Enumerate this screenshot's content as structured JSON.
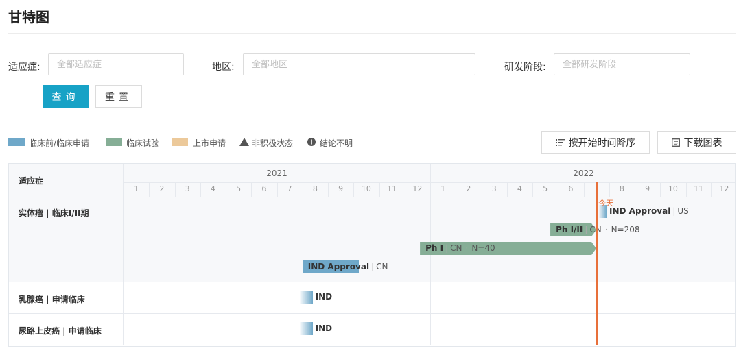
{
  "page": {
    "title": "甘特图"
  },
  "filters": [
    {
      "label": "适应症:",
      "placeholder": "全部适应症"
    },
    {
      "label": "地区:",
      "placeholder": "全部地区"
    },
    {
      "label": "研发阶段:",
      "placeholder": "全部研发阶段"
    }
  ],
  "buttons": {
    "query": "查询",
    "reset": "重置"
  },
  "legend": [
    {
      "type": "swatch",
      "color": "#6fa8c9",
      "label": "临床前/临床申请"
    },
    {
      "type": "swatch",
      "color": "#86ae96",
      "label": "临床试验"
    },
    {
      "type": "swatch",
      "color": "#ecc99a",
      "label": "上市申请"
    },
    {
      "type": "triangle",
      "icon": "triangle-icon",
      "label": "非积极状态"
    },
    {
      "type": "info",
      "icon": "exclamation-circle-icon",
      "label": "结论不明"
    }
  ],
  "toolbar": {
    "sort_label": "按开始时间降序",
    "download_label": "下载图表"
  },
  "gantt": {
    "header_label": "适应症",
    "years": [
      "2021",
      "2022"
    ],
    "months": [
      "1",
      "2",
      "3",
      "4",
      "5",
      "6",
      "7",
      "8",
      "9",
      "10",
      "11",
      "12"
    ],
    "today_label": "今天",
    "today_position": "2022-07.5",
    "rows": [
      {
        "label": "实体瘤 | 临床I/II期"
      },
      {
        "label": "乳腺癌 | 申请临床"
      },
      {
        "label": "尿路上皮癌 | 申请临床"
      }
    ],
    "bars": [
      {
        "row": 0,
        "lane": 0,
        "phase": "IND Approval",
        "region": "US",
        "start": "2022-07.6",
        "end": "2022-07.9",
        "color": "#6fa8c9",
        "style": "fade"
      },
      {
        "row": 0,
        "lane": 1,
        "phase": "Ph I/II",
        "region": "CN",
        "n": "N=208",
        "start": "2022-05.7",
        "end": "2022-07.5",
        "color": "#86ae96",
        "style": "arrow"
      },
      {
        "row": 0,
        "lane": 2,
        "phase": "Ph I",
        "region": "CN",
        "n": "N=40",
        "start": "2021-12.6",
        "end": "2022-07.5",
        "color": "#86ae96",
        "style": "arrow"
      },
      {
        "row": 0,
        "lane": 3,
        "phase": "IND Approval",
        "region": "CN",
        "start": "2021-08.0",
        "end": "2021-10.2",
        "color": "#6fa8c9",
        "style": "solid"
      },
      {
        "row": 1,
        "lane": 0,
        "phase": "IND",
        "start": "2021-07.9",
        "end": "2021-08.4",
        "color": "#6fa8c9",
        "style": "fade"
      },
      {
        "row": 2,
        "lane": 0,
        "phase": "IND",
        "start": "2021-07.9",
        "end": "2021-08.4",
        "color": "#6fa8c9",
        "style": "fade"
      }
    ]
  }
}
